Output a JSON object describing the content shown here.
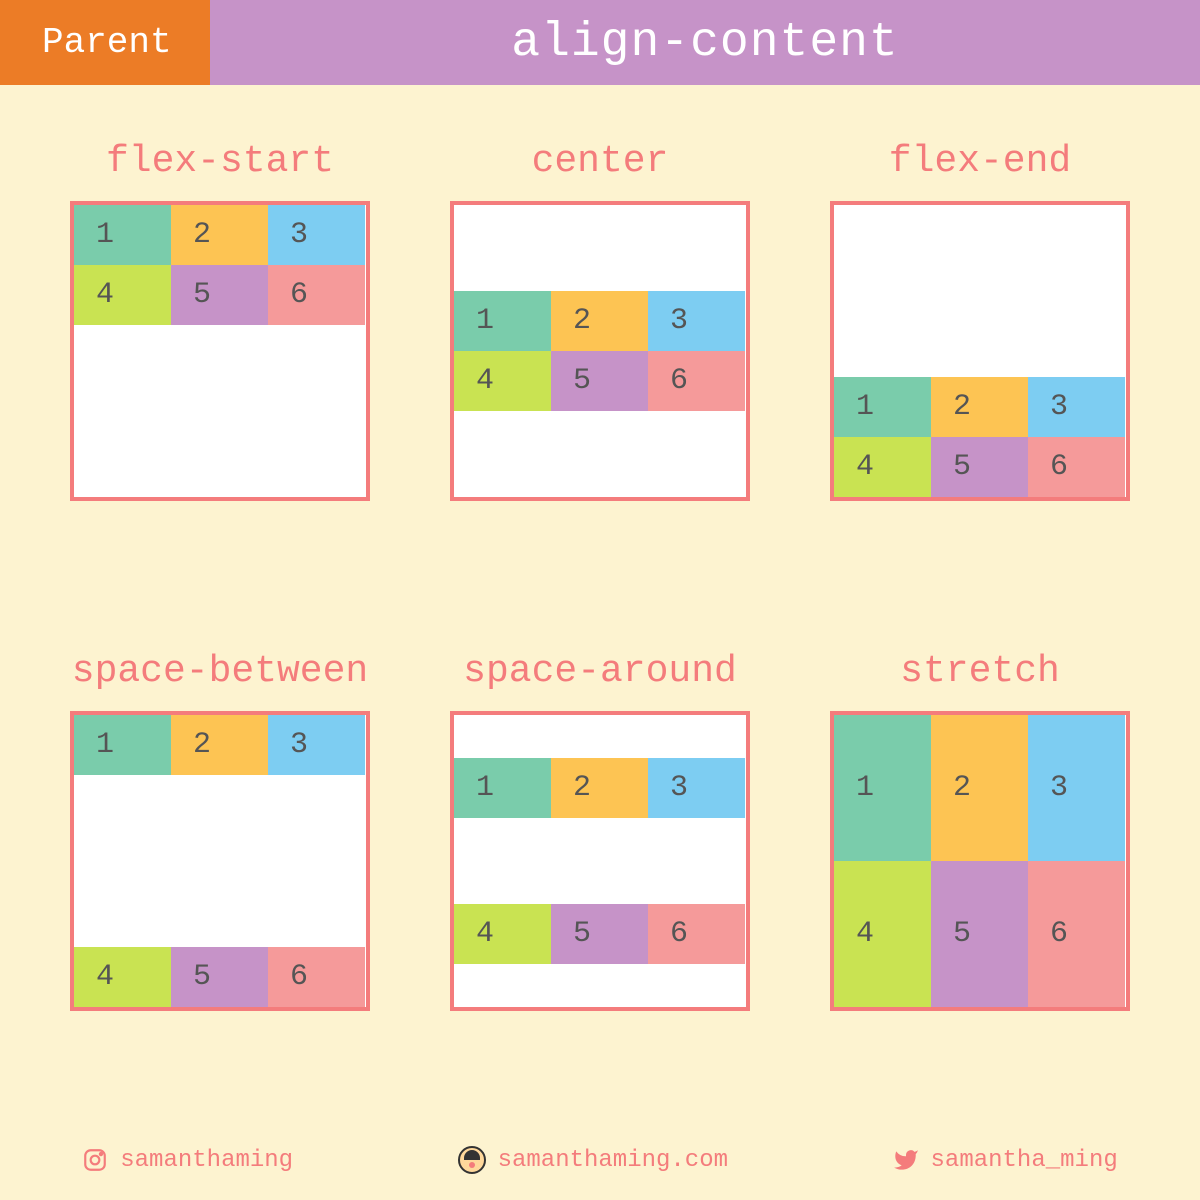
{
  "header": {
    "left": "Parent",
    "right": "align-content"
  },
  "examples": [
    {
      "title": "flex-start",
      "class": "ac-flex-start"
    },
    {
      "title": "center",
      "class": "ac-center"
    },
    {
      "title": "flex-end",
      "class": "ac-flex-end"
    },
    {
      "title": "space-between",
      "class": "ac-space-between"
    },
    {
      "title": "space-around",
      "class": "ac-space-around"
    },
    {
      "title": "stretch",
      "class": "ac-stretch"
    }
  ],
  "items": [
    "1",
    "2",
    "3",
    "4",
    "5",
    "6"
  ],
  "footer": {
    "instagram": "samanthaming",
    "website": "samanthaming.com",
    "twitter": "samantha_ming"
  }
}
